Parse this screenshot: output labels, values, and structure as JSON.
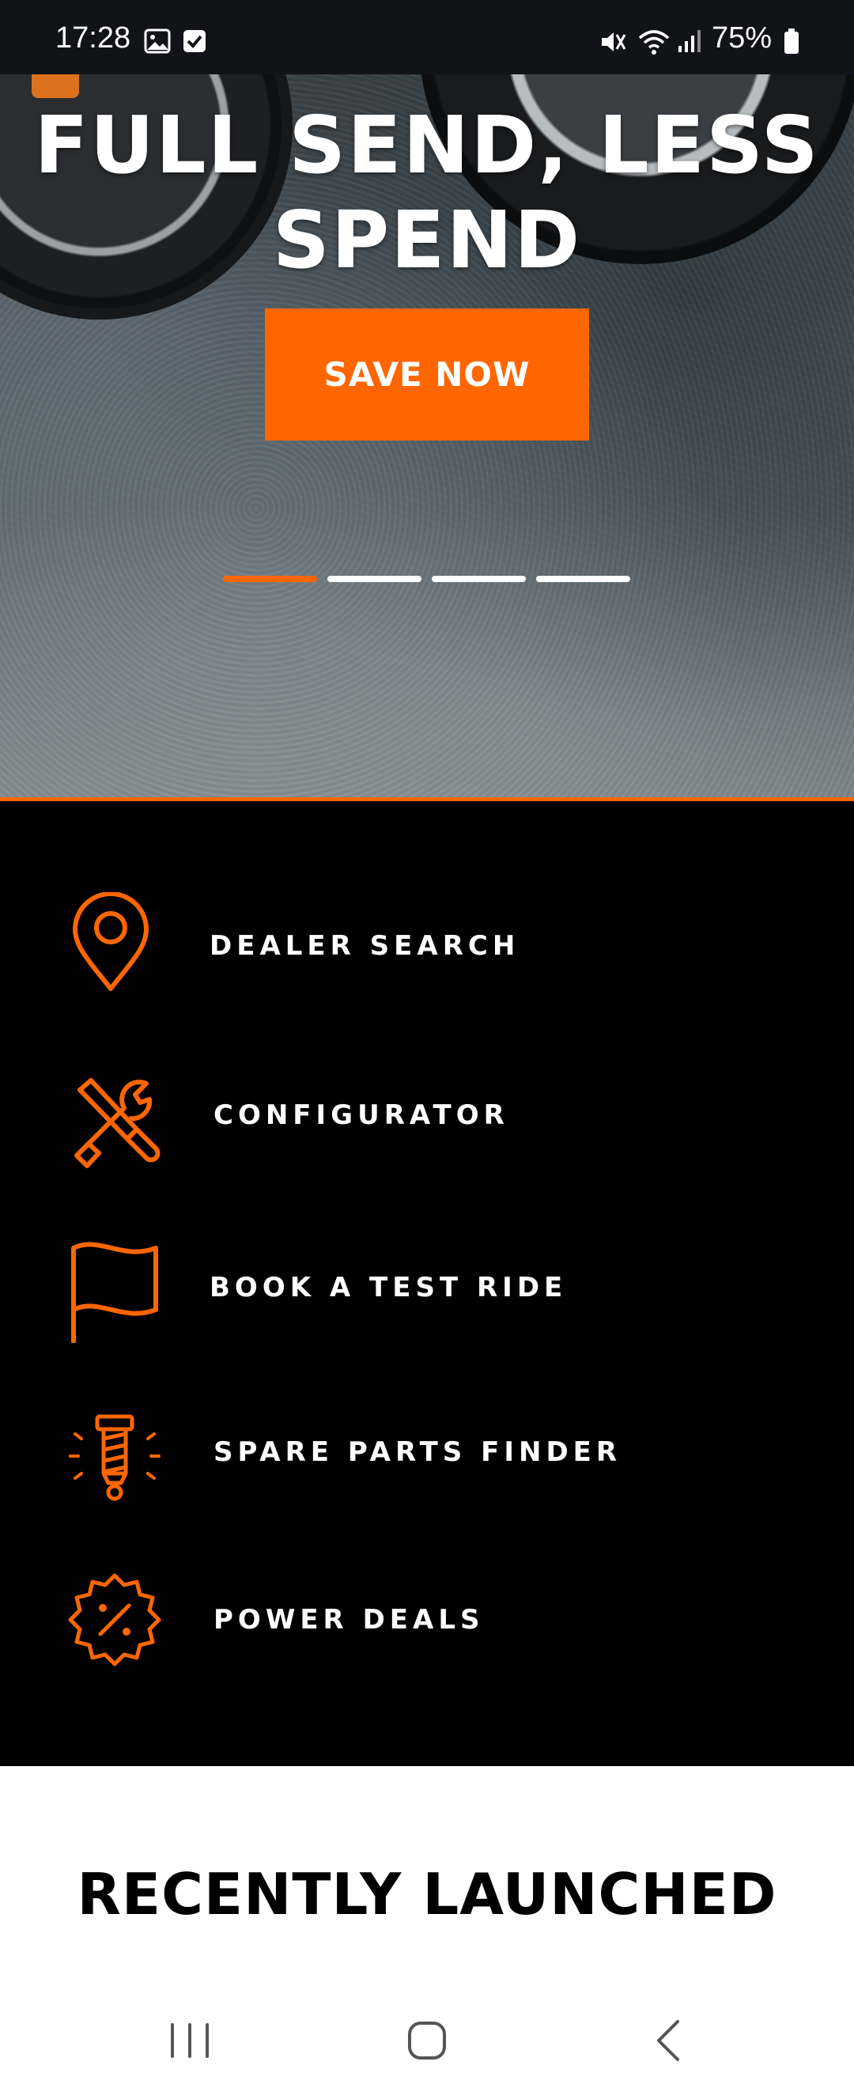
{
  "status_bar": {
    "time": "17:28",
    "battery": "75%",
    "icons": [
      "gallery-icon",
      "checkbox-icon",
      "mute-icon",
      "wifi-icon",
      "signal-icon",
      "battery-icon"
    ]
  },
  "hero": {
    "title_line1": "FULL SEND, LESS",
    "title_line2": "SPEND",
    "cta_label": "SAVE NOW",
    "carousel": {
      "slides": 4,
      "active_index": 0
    },
    "accent_color": "#ff6600"
  },
  "menu": {
    "items": [
      {
        "label": "DEALER SEARCH",
        "icon": "location-pin-icon"
      },
      {
        "label": "CONFIGURATOR",
        "icon": "tools-icon"
      },
      {
        "label": "BOOK A TEST RIDE",
        "icon": "flag-icon"
      },
      {
        "label": "SPARE PARTS FINDER",
        "icon": "spare-part-icon"
      },
      {
        "label": "POWER DEALS",
        "icon": "discount-badge-icon"
      }
    ]
  },
  "recently_launched": {
    "title": "RECENTLY LAUNCHED"
  },
  "nav_bar": {
    "buttons": [
      "recents-icon",
      "home-icon",
      "back-icon"
    ]
  }
}
